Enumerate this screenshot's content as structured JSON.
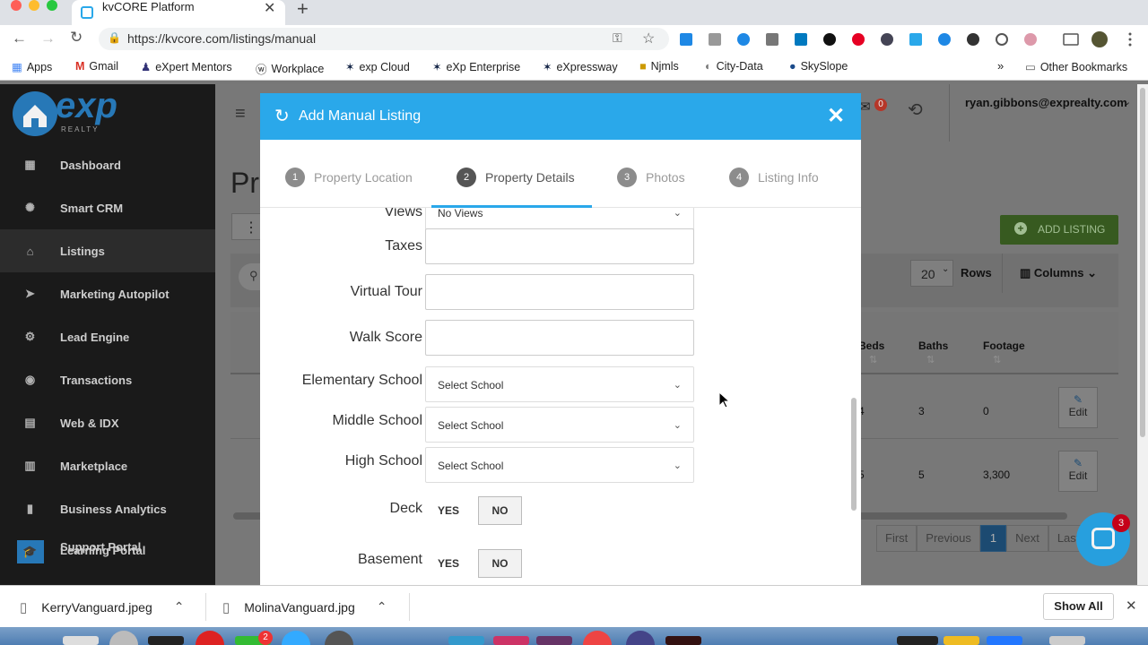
{
  "browser": {
    "tab_title": "kvCORE Platform",
    "url": "https://kvcore.com/listings/manual",
    "bookmarks": [
      "Apps",
      "Gmail",
      "eXpert Mentors",
      "Workplace",
      "exp Cloud",
      "eXp Enterprise",
      "eXpressway",
      "Njmls",
      "City-Data",
      "SkySlope"
    ],
    "other_bookmarks": "Other Bookmarks"
  },
  "sidebar": {
    "brand": "exp",
    "brand_sub": "REALTY",
    "items": [
      {
        "label": "Dashboard",
        "icon": "dashboard-icon"
      },
      {
        "label": "Smart CRM",
        "icon": "crm-icon"
      },
      {
        "label": "Listings",
        "icon": "home-icon"
      },
      {
        "label": "Marketing Autopilot",
        "icon": "paper-plane-icon"
      },
      {
        "label": "Lead Engine",
        "icon": "lead-engine-icon"
      },
      {
        "label": "Transactions",
        "icon": "transactions-icon"
      },
      {
        "label": "Web & IDX",
        "icon": "web-icon"
      },
      {
        "label": "Marketplace",
        "icon": "marketplace-icon"
      },
      {
        "label": "Business Analytics",
        "icon": "analytics-icon"
      },
      {
        "label": "Support Portal",
        "icon": "support-icon"
      }
    ],
    "overlap_label": "Learning Portal"
  },
  "topbar": {
    "user": "ryan.gibbons@exprealty.com",
    "notification_count": "0"
  },
  "background": {
    "page_title_partial": "Pro",
    "add_listing": "ADD LISTING",
    "rows_value": "20",
    "rows_label": "Rows",
    "columns_label": "Columns",
    "headers": [
      "Beds",
      "Baths",
      "Footage"
    ],
    "rows": [
      {
        "beds": "4",
        "baths": "3",
        "footage": "0",
        "edit": "Edit"
      },
      {
        "beds": "5",
        "baths": "5",
        "footage": "3,300",
        "edit": "Edit"
      }
    ],
    "pagination": [
      "First",
      "Previous",
      "1",
      "Next",
      "Last"
    ],
    "chat_badge": "3"
  },
  "modal": {
    "title": "Add Manual Listing",
    "steps": [
      {
        "num": "1",
        "label": "Property Location"
      },
      {
        "num": "2",
        "label": "Property Details"
      },
      {
        "num": "3",
        "label": "Photos"
      },
      {
        "num": "4",
        "label": "Listing Info"
      }
    ],
    "fields": {
      "views": {
        "label": "Views",
        "value": "No Views"
      },
      "taxes": {
        "label": "Taxes",
        "value": ""
      },
      "virtual_tour": {
        "label": "Virtual Tour",
        "value": ""
      },
      "walk_score": {
        "label": "Walk Score",
        "value": ""
      },
      "elementary_school": {
        "label": "Elementary School",
        "value": "Select School"
      },
      "middle_school": {
        "label": "Middle School",
        "value": "Select School"
      },
      "high_school": {
        "label": "High School",
        "value": "Select School"
      },
      "deck": {
        "label": "Deck",
        "yes": "YES",
        "no": "NO"
      },
      "basement": {
        "label": "Basement",
        "yes": "YES",
        "no": "NO"
      }
    }
  },
  "downloads": {
    "files": [
      "KerryVanguard.jpeg",
      "MolinaVanguard.jpg"
    ],
    "show_all": "Show All"
  },
  "colors": {
    "modal_header": "#2aa8ea",
    "add_listing": "#6eb343",
    "active_page": "#2d8fd5"
  }
}
